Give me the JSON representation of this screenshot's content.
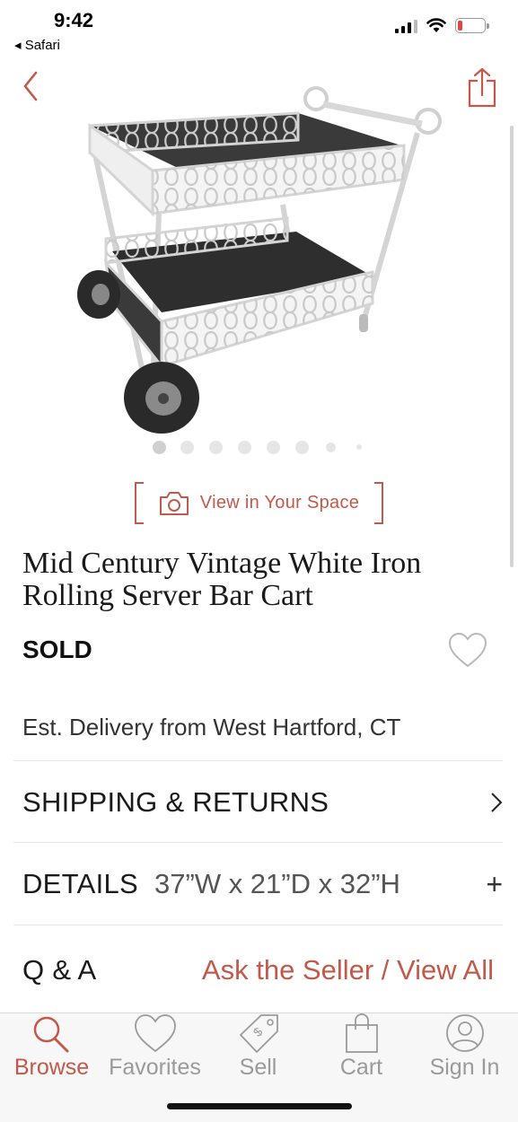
{
  "status": {
    "time": "9:42",
    "back_app": "◂ Safari",
    "battery_level": 0.18,
    "battery_color": "#e8423f"
  },
  "nav": {
    "back_icon": "chevron-left-icon",
    "share_icon": "share-icon"
  },
  "carousel": {
    "dot_count": 8,
    "active_index": 0
  },
  "view_in_space": {
    "label": "View in Your Space",
    "icon": "camera-icon"
  },
  "product": {
    "title_line1": "Mid Century Vintage White Iron",
    "title_line2": "Rolling Server Bar Cart",
    "status": "SOLD",
    "delivery": "Est. Delivery from West Hartford, CT"
  },
  "sections": {
    "shipping_label": "SHIPPING & RETURNS",
    "details_label": "DETAILS",
    "details_value": "37”W x 21”D x 32”H",
    "qa_label": "Q & A",
    "qa_link": "Ask the Seller / View All"
  },
  "tabs": [
    {
      "label": "Browse",
      "icon": "search-icon",
      "active": true
    },
    {
      "label": "Favorites",
      "icon": "heart-icon",
      "active": false
    },
    {
      "label": "Sell",
      "icon": "price-tag-icon",
      "active": false
    },
    {
      "label": "Cart",
      "icon": "shopping-bag-icon",
      "active": false
    },
    {
      "label": "Sign In",
      "icon": "user-icon",
      "active": false
    }
  ],
  "colors": {
    "accent": "#c2594a",
    "tab_inactive": "#9a9a9a"
  }
}
